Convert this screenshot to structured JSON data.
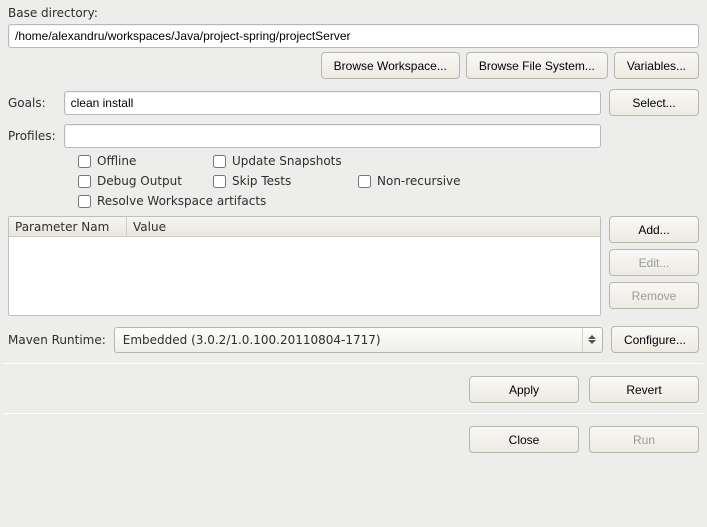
{
  "baseDirectory": {
    "label": "Base directory:",
    "value": "/home/alexandru/workspaces/Java/project-spring/projectServer"
  },
  "goals": {
    "label": "Goals:",
    "value": "clean install"
  },
  "profiles": {
    "label": "Profiles:",
    "value": ""
  },
  "checkboxes": {
    "offline": "Offline",
    "updateSnapshots": "Update Snapshots",
    "debugOutput": "Debug Output",
    "skipTests": "Skip Tests",
    "nonRecursive": "Non-recursive",
    "resolveWorkspace": "Resolve Workspace artifacts"
  },
  "table": {
    "columns": [
      "Parameter Nam",
      "Value"
    ]
  },
  "mavenRuntime": {
    "label": "Maven Runtime:",
    "value": "Embedded (3.0.2/1.0.100.20110804-1717)"
  },
  "buttons": {
    "browseWorkspace": "Browse Workspace...",
    "browseFileSystem": "Browse File System...",
    "variables": "Variables...",
    "select": "Select...",
    "add": "Add...",
    "edit": "Edit...",
    "remove": "Remove",
    "configure": "Configure...",
    "apply": "Apply",
    "revert": "Revert",
    "close": "Close",
    "run": "Run"
  }
}
